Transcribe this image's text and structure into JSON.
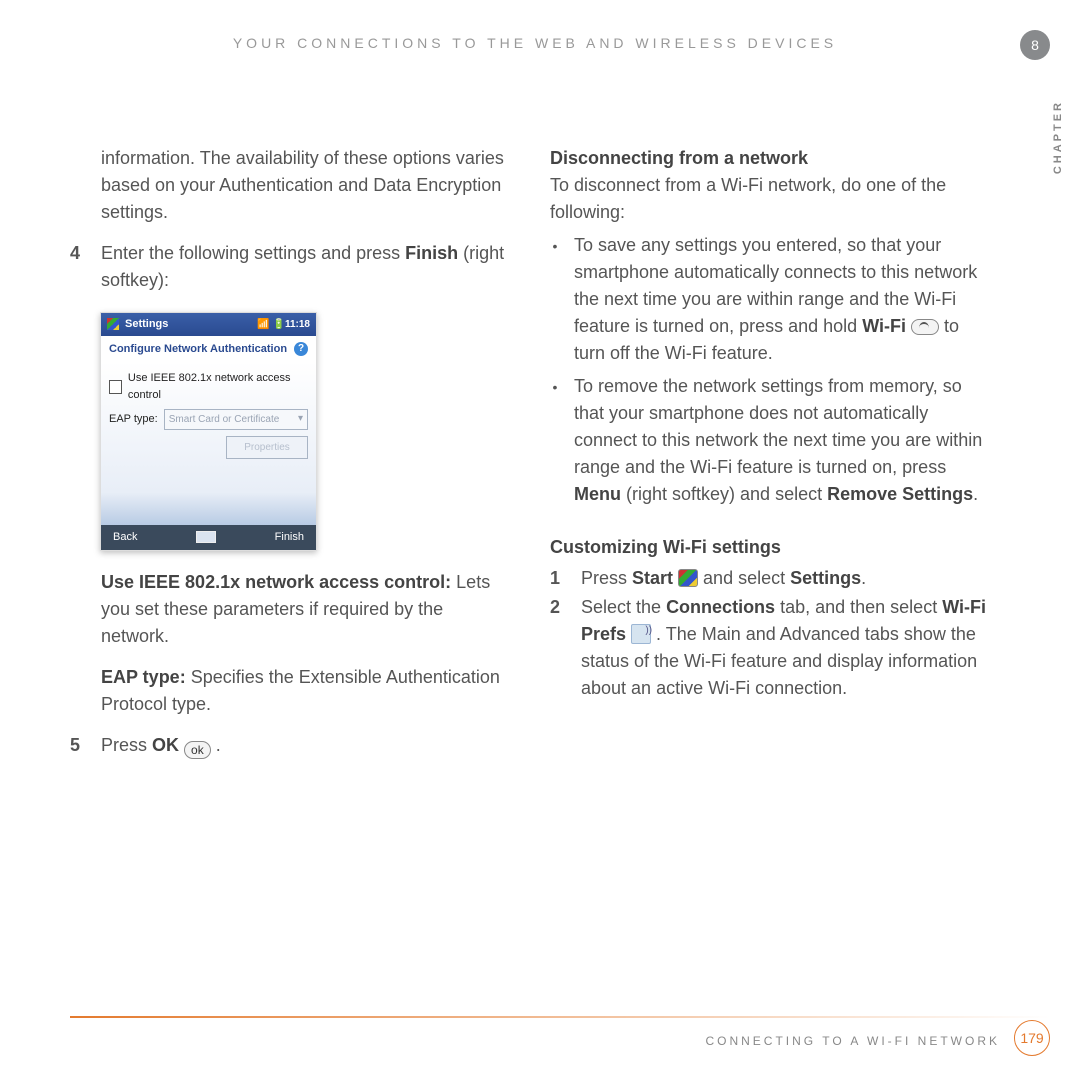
{
  "header": {
    "title": "YOUR CONNECTIONS TO THE WEB AND WIRELESS DEVICES",
    "chapter_number": "8",
    "chapter_label": "CHAPTER"
  },
  "left": {
    "intro": "information. The availability of these options varies based on your Authentication and Data Encryption settings.",
    "step4_num": "4",
    "step4_a": "Enter the following settings and press ",
    "step4_bold": "Finish",
    "step4_b": " (right softkey):",
    "use_ieee_bold": "Use IEEE 802.1x network access control:",
    "use_ieee_rest": " Lets you set these parameters if required by the network.",
    "eap_bold": "EAP type:",
    "eap_rest": " Specifies the Extensible Authentication Protocol type.",
    "step5_num": "5",
    "step5_a": "Press ",
    "step5_bold": "OK",
    "step5_btn": "ok",
    "step5_b": " ."
  },
  "phone": {
    "title": "Settings",
    "time": "11:18",
    "subhead": "Configure Network Authentication",
    "checkbox_label": "Use IEEE 802.1x network access control",
    "eap_label": "EAP type:",
    "eap_value": "Smart Card or Certificate",
    "props_btn": "Properties",
    "soft_left": "Back",
    "soft_right": "Finish"
  },
  "right": {
    "disc_head": "Disconnecting from a network",
    "disc_intro": "To disconnect from a Wi-Fi network, do one of the following:",
    "b1_a": "To save any settings you entered, so that your smartphone automatically connects to this network the next time you are within range and the Wi-Fi feature is turned on, press and hold ",
    "b1_bold": "Wi-Fi",
    "b1_b": " to turn off the Wi-Fi feature.",
    "b2_a": "To remove the network settings from memory, so that your smartphone does not automatically connect to this network the next time you are within range and the Wi-Fi feature is turned on, press ",
    "b2_bold1": "Menu",
    "b2_b": " (right softkey) and select ",
    "b2_bold2": "Remove Settings",
    "b2_c": ".",
    "cust_head": "Customizing Wi-Fi settings",
    "s1_num": "1",
    "s1_a": "Press ",
    "s1_bold1": "Start",
    "s1_b": " and select ",
    "s1_bold2": "Settings",
    "s1_c": ".",
    "s2_num": "2",
    "s2_a": "Select the ",
    "s2_bold1": "Connections",
    "s2_b": " tab, and then select ",
    "s2_bold2": "Wi-Fi Prefs",
    "s2_c": " . The Main and Advanced tabs show the status of the Wi-Fi feature and display information about an active Wi-Fi connection."
  },
  "footer": {
    "text": "CONNECTING TO A WI-FI NETWORK",
    "page": "179"
  }
}
